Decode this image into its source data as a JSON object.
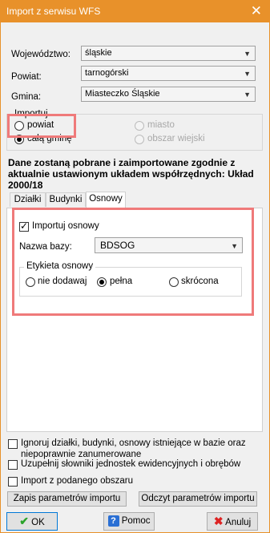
{
  "window": {
    "title": "Import z serwisu WFS"
  },
  "fields": {
    "wojewodztwo": {
      "label": "Województwo:",
      "value": "śląskie"
    },
    "powiat": {
      "label": "Powiat:",
      "value": "tarnogórski"
    },
    "gmina": {
      "label": "Gmina:",
      "value": "Miasteczko Śląskie"
    }
  },
  "importuj": {
    "legend": "Importuj",
    "powiat": "powiat",
    "cala_gmine": "całą gminę",
    "miasto": "miasto",
    "obszar_wiejski": "obszar wiejski"
  },
  "info": "Dane zostaną pobrane i zaimportowane zgodnie z aktualnie ustawionym układem współrzędnych: Układ 2000/18",
  "tabs": [
    "Działki",
    "Budynki",
    "Osnowy"
  ],
  "osnowy": {
    "import_checkbox": "Importuj osnowy",
    "nazwa_bazy_label": "Nazwa bazy:",
    "nazwa_bazy_value": "BDSOG",
    "etykieta_legend": "Etykieta osnowy",
    "opt1": "nie dodawaj",
    "opt2": "pełna",
    "opt3": "skrócona"
  },
  "options": {
    "ignore": "Ignoruj działki, budynki, osnowy istniejące w bazie oraz niepoprawnie zanumerowane",
    "ignore_line1": "Ignoruj działki, budynki, osnowy istniejące w bazie oraz",
    "ignore_line2": "niepoprawnie zanumerowane",
    "uzupelnij": "Uzupełnij słowniki jednostek ewidencyjnych i obrębów",
    "obszar": "Import z podanego obszaru"
  },
  "buttons": {
    "zapis": "Zapis parametrów importu",
    "odczyt": "Odczyt parametrów importu",
    "ok": "OK",
    "pomoc": "Pomoc",
    "anuluj": "Anuluj"
  },
  "colors": {
    "titlebar": "#e8912a",
    "highlight": "#ef7a7a"
  }
}
